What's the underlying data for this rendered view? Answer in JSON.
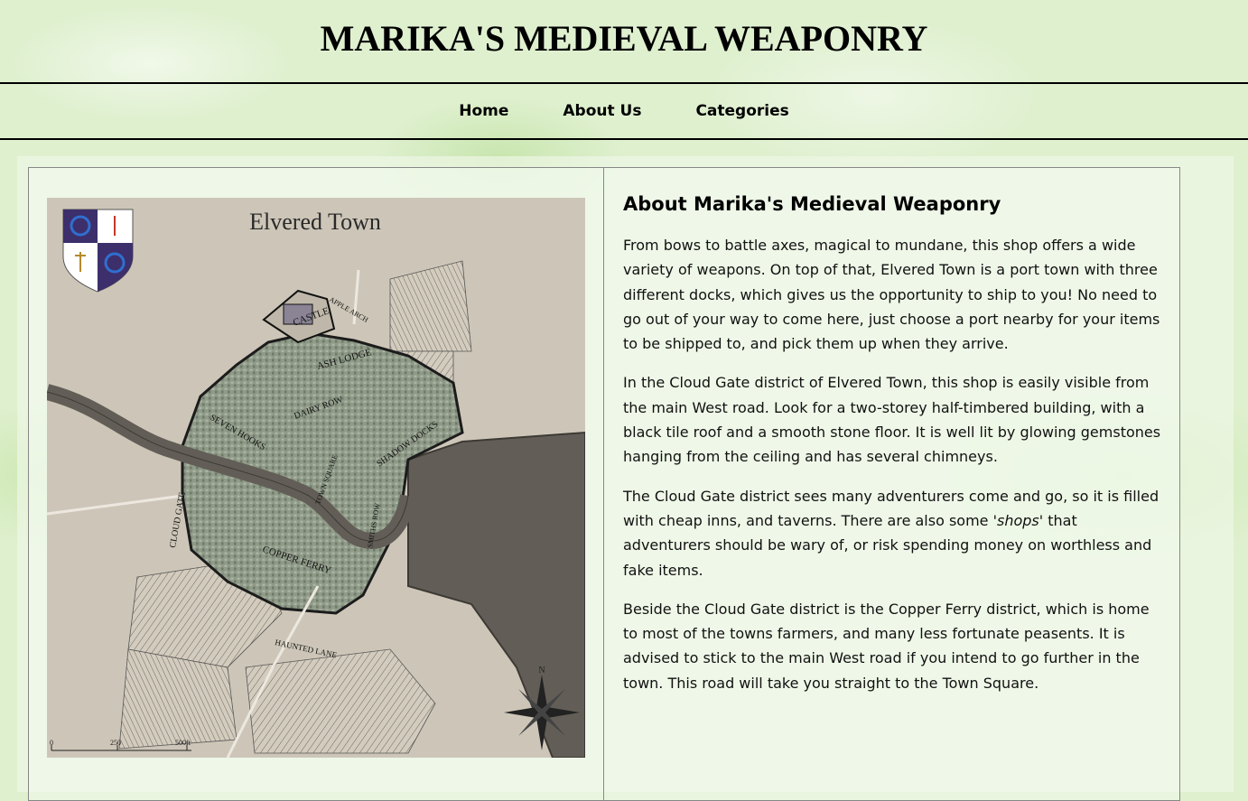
{
  "header": {
    "title": "MARIKA'S MEDIEVAL WEAPONRY"
  },
  "nav": {
    "items": [
      "Home",
      "About Us",
      "Categories"
    ]
  },
  "map": {
    "title": "Elvered Town",
    "districts": [
      "CASTLE",
      "ASH LODGE",
      "DAIRY ROW",
      "SEVEN HOOKS",
      "SHADOW DOCKS",
      "CLOUD GATE",
      "COPPER FERRY",
      "TOWN SQUARE",
      "APPLE ARCH",
      "HAUNTED LANE",
      "SMITHS ROW"
    ],
    "compass": "N",
    "scale": [
      "0",
      "250",
      "500ft"
    ],
    "colors": {
      "land": "#cdc6b8",
      "water": "#625e57",
      "buildings": "#8c9686",
      "walls": "#222222"
    }
  },
  "about": {
    "heading": "About Marika's Medieval Weaponry",
    "p1": "From bows to battle axes, magical to mundane, this shop offers a wide variety of weapons. On top of that, Elvered Town is a port town with three different docks, which gives us the opportunity to ship to you! No need to go out of your way to come here, just choose a port nearby for your items to be shipped to, and pick them up when they arrive.",
    "p2": "In the Cloud Gate district of Elvered Town, this shop is easily visible from the main West road. Look for a two-storey half-timbered building, with a black tile roof and a smooth stone floor. It is well lit by glowing gemstones hanging from the ceiling and has several chimneys.",
    "p3_before": "The Cloud Gate district sees many adventurers come and go, so it is filled with cheap inns, and taverns. There are also some ",
    "p3_em": "'shops'",
    "p3_after": " that adventurers should be wary of, or risk spending money on worthless and fake items.",
    "p4": "Beside the Cloud Gate district is the Copper Ferry district, which is home to most of the towns farmers, and many less fortunate peasents. It is advised to stick to the main West road if you intend to go further in the town. This road will take you straight to the Town Square."
  }
}
